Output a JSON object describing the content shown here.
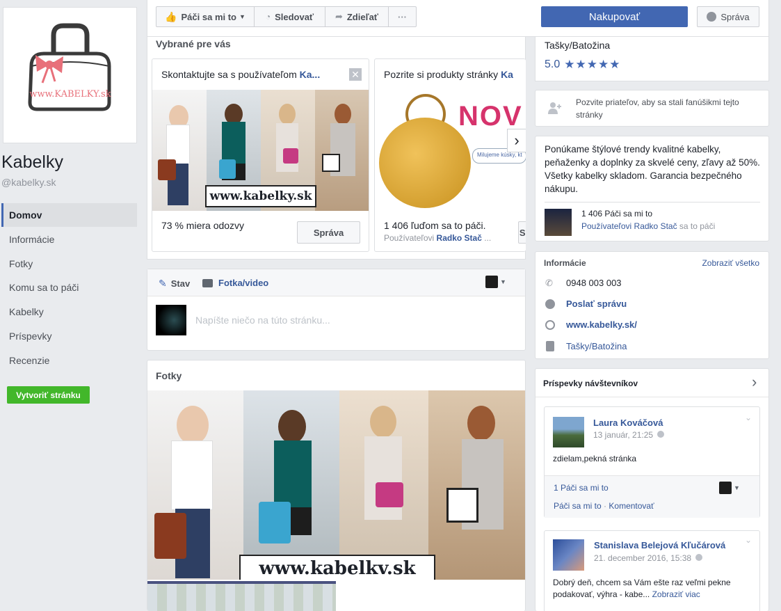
{
  "page": {
    "name": "Kabelky",
    "handle": "@kabelky.sk",
    "logo_text": "www.KABELKY.sk"
  },
  "nav": {
    "items": [
      "Domov",
      "Informácie",
      "Fotky",
      "Komu sa to páči",
      "Kabelky",
      "Príspevky",
      "Recenzie"
    ],
    "create_page": "Vytvoriť stránku"
  },
  "actions": {
    "like": "Páči sa mi to",
    "follow": "Sledovať",
    "share": "Zdieľať",
    "more": "···",
    "shop": "Nakupovať",
    "message": "Správa"
  },
  "suggested": {
    "title": "Vybrané pre vás",
    "card1": {
      "header_prefix": "Skontaktujte sa s používateľom ",
      "header_link": "Ka...",
      "banner_text": "www.kabelky.sk",
      "stat": "73 % miera odozvy",
      "button": "Správa"
    },
    "card2": {
      "header_prefix": "Pozrite si produkty stránky ",
      "header_link": "Ka",
      "banner_text": "NOV",
      "banner_sub": "Milujeme kúsky, kt",
      "stat": "1 406 ľuďom sa to páči.",
      "sub_prefix": "Používateľovi ",
      "sub_link": "Radko Stač",
      "sub_suffix": " ...",
      "button": "Správ"
    }
  },
  "composer": {
    "tab_status": "Stav",
    "tab_photo": "Fotka/video",
    "placeholder": "Napíšte niečo na túto stránku..."
  },
  "photos": {
    "title": "Fotky",
    "banner_text": "www.kabelkv.sk"
  },
  "sidebar": {
    "category": "Tašky/Batožina",
    "rating": "5.0",
    "stars": "★★★★★",
    "invite": "Pozvite priateľov, aby sa stali fanúšikmi tejto stránky",
    "about": "Ponúkame štýlové trendy kvalitné kabelky, peňaženky a doplnky za skvelé ceny, zľavy až 50%. Všetky kabelky skladom. Garancia bezpečného nákupu.",
    "likes_count": "1 406 Páči sa mi to",
    "likes_friend": "Používateľovi Radko Stač",
    "likes_friend_suffix": " sa to páči",
    "info": {
      "title": "Informácie",
      "see_all": "Zobraziť všetko",
      "phone": "0948 003 003",
      "send_message": "Poslať správu",
      "website": "www.kabelky.sk/",
      "category": "Tašky/Batožina"
    },
    "visitor_posts": {
      "title": "Príspevky návštevníkov",
      "posts": [
        {
          "author": "Laura Kováčová",
          "date": "13 január, 21:25",
          "text": "zdielam,pekná stránka",
          "likes": "1 Páči sa mi to",
          "like_action": "Páči sa mi to",
          "comment_action": "Komentovať"
        },
        {
          "author": "Stanislava Belejová Kľučárová",
          "date": "21. december 2016, 15:38",
          "text": "Dobrý deň, chcem sa Vám ešte raz veľmi pekne podakovať, výhra - kabe...",
          "see_more": "Zobraziť viac"
        }
      ]
    }
  },
  "colors": {
    "fb_blue": "#4267b2",
    "link": "#365899",
    "green": "#42b72a",
    "logo_pink": "#e8707a"
  }
}
